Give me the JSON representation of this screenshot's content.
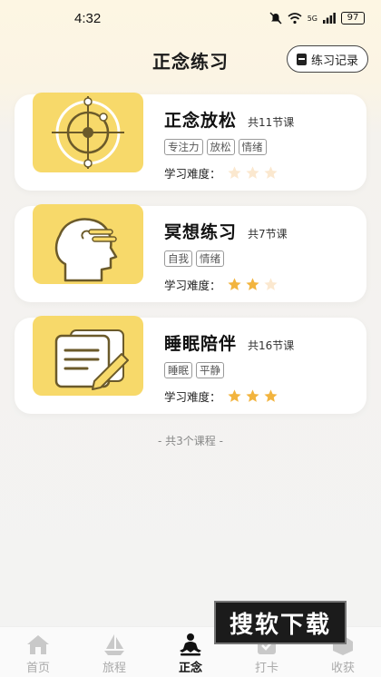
{
  "status_bar": {
    "time": "4:32",
    "signal": "5G",
    "battery": "97"
  },
  "header": {
    "title": "正念练习",
    "record_label": "练习记录"
  },
  "courses": [
    {
      "title": "正念放松",
      "count": "共11节课",
      "tags": [
        "专注力",
        "放松",
        "情绪"
      ],
      "difficulty_label": "学习难度：",
      "difficulty": 0
    },
    {
      "title": "冥想练习",
      "count": "共7节课",
      "tags": [
        "自我",
        "情绪"
      ],
      "difficulty_label": "学习难度：",
      "difficulty": 2
    },
    {
      "title": "睡眠陪伴",
      "count": "共16节课",
      "tags": [
        "睡眠",
        "平静"
      ],
      "difficulty_label": "学习难度：",
      "difficulty": 3
    }
  ],
  "footer_note": "- 共3个课程 -",
  "nav": [
    {
      "label": "首页",
      "icon": "home-icon",
      "active": false
    },
    {
      "label": "旅程",
      "icon": "sailboat-icon",
      "active": false
    },
    {
      "label": "正念",
      "icon": "meditation-icon",
      "active": true
    },
    {
      "label": "打卡",
      "icon": "checkin-icon",
      "active": false
    },
    {
      "label": "收获",
      "icon": "harvest-icon",
      "active": false
    }
  ],
  "watermark": "搜软下载",
  "colors": {
    "accent": "#f7d96a",
    "star_on": "#f2b43e",
    "star_off": "#fbe8cf"
  }
}
